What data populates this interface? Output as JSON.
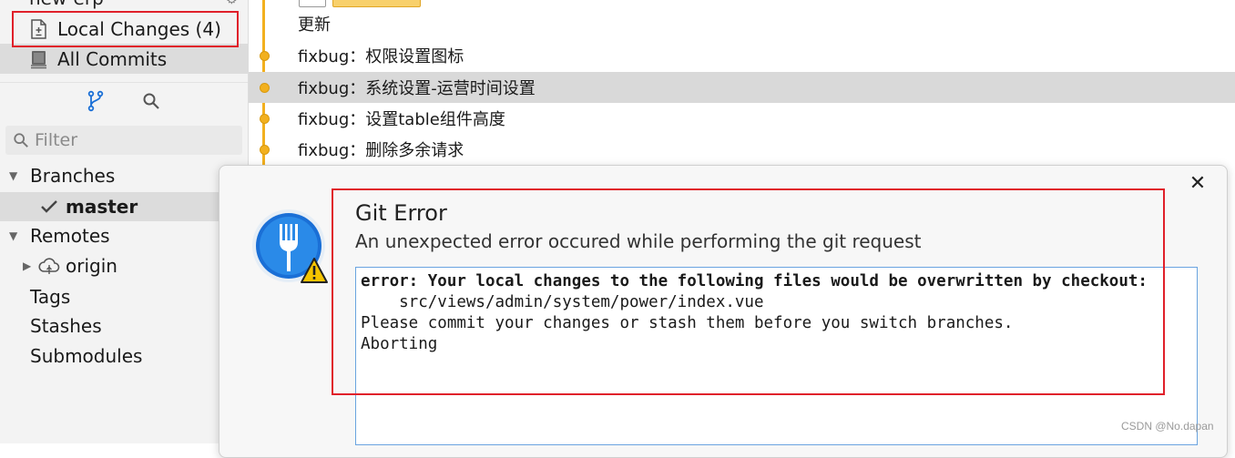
{
  "sidebar": {
    "repo_title": "new-erp",
    "local_changes": "Local Changes (4)",
    "all_commits": "All Commits",
    "filter_placeholder": "Filter",
    "branches_header": "Branches",
    "branch_master": "master",
    "remotes_header": "Remotes",
    "remote_origin": "origin",
    "tags": "Tags",
    "stashes": "Stashes",
    "submodules": "Submodules"
  },
  "commits": [
    "更新",
    "fixbug：权限设置图标",
    "fixbug：系统设置-运营时间设置",
    "fixbug：设置table组件高度",
    "fixbug：删除多余请求"
  ],
  "dialog": {
    "title": "Git Error",
    "subtitle": "An unexpected error occured while performing the git request",
    "lines": [
      "error: Your local changes to the following files would be overwritten by checkout:",
      "    src/views/admin/system/power/index.vue",
      "Please commit your changes or stash them before you switch branches.",
      "Aborting"
    ],
    "close": "✕"
  },
  "colors": {
    "accent_blue": "#1a6fd6",
    "graph_orange": "#f2b01e",
    "highlight_red": "#e0202a"
  },
  "watermark": "CSDN @No.dapan"
}
